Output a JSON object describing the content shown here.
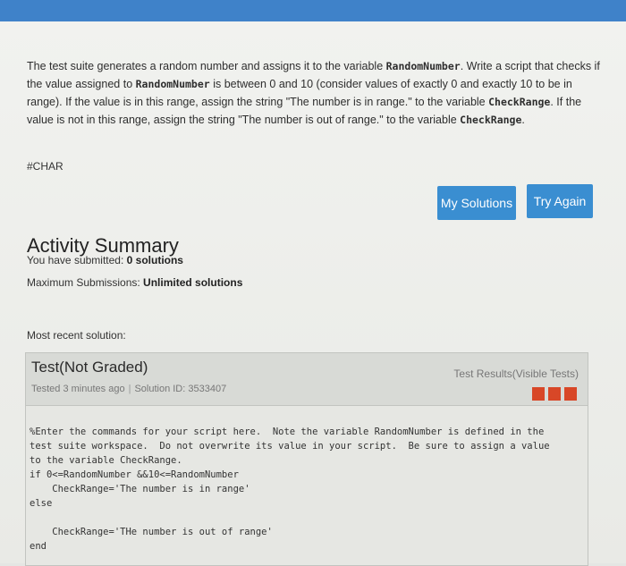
{
  "prompt": {
    "p1": "The test suite generates a random number and assigns it to the variable ",
    "var1": "RandomNumber",
    "p2": ". Write a script that checks if the value assigned to ",
    "var2": "RandomNumber",
    "p3": " is between 0 and 10 (consider values of exactly 0 and exactly 10 to be in range). If the value is in this range, assign the string \"The number is in range.\" to the variable ",
    "var3": "CheckRange",
    "p4": ". If the value is not in this range, assign the string \"The number is out of range.\" to the variable ",
    "var4": "CheckRange",
    "p5": "."
  },
  "char_tag": "#CHAR",
  "buttons": {
    "my_solutions": "My Solutions",
    "try_again": "Try Again"
  },
  "summary": {
    "heading": "Activity Summary",
    "submitted_label": "You have submitted: ",
    "submitted_value": "0 solutions",
    "max_label": "Maximum Submissions: ",
    "max_value": "Unlimited solutions"
  },
  "recent": {
    "label": "Most recent solution:",
    "title": "Test(Not Graded)",
    "tested": "Tested 3 minutes ago",
    "solution_id": "Solution ID: 3533407",
    "results_label": "Test Results(Visible Tests)",
    "result_color": "#d84727",
    "result_count": 3,
    "code": "%Enter the commands for your script here.  Note the variable RandomNumber is defined in the\ntest suite workspace.  Do not overwrite its value in your script.  Be sure to assign a value\nto the variable CheckRange.\nif 0<=RandomNumber &&10<=RandomNumber\n    CheckRange='The number is in range'\nelse\n\n    CheckRange='THe number is out of range'\nend"
  }
}
